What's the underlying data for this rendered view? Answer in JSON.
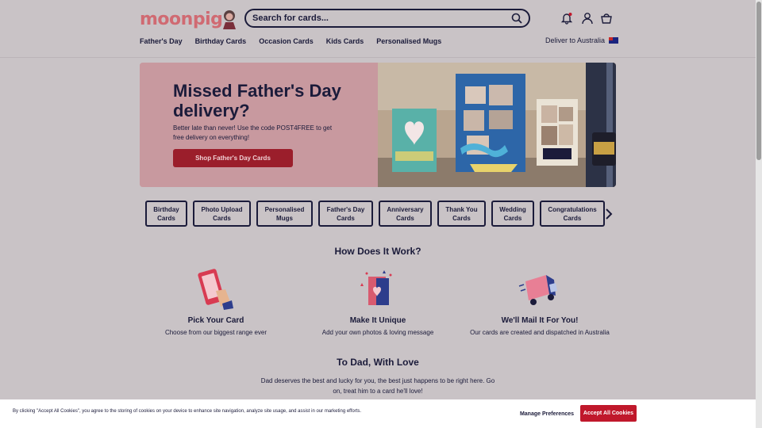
{
  "header": {
    "logo_text": "moonpig",
    "search_placeholder": "Search for cards...",
    "icons": [
      "search-icon",
      "bell-icon",
      "account-icon",
      "basket-icon"
    ]
  },
  "nav": {
    "items": [
      "Father's Day",
      "Birthday Cards",
      "Occasion Cards",
      "Kids Cards",
      "Personalised Mugs"
    ],
    "deliver_label": "Deliver to Australia"
  },
  "hero": {
    "title": "Missed Father's Day delivery?",
    "subtitle": "Better late than never! Use the code POST4FREE to get free delivery on everything!",
    "cta_label": "Shop Father's Day Cards"
  },
  "categories": [
    "Birthday\nCards",
    "Photo Upload\nCards",
    "Personalised\nMugs",
    "Father's Day\nCards",
    "Anniversary\nCards",
    "Thank You\nCards",
    "Wedding\nCards",
    "Congratulations\nCards"
  ],
  "how": {
    "title": "How Does It Work?",
    "steps": [
      {
        "title": "Pick Your Card",
        "desc": "Choose from our biggest range ever"
      },
      {
        "title": "Make It Unique",
        "desc": "Add your own photos & loving message"
      },
      {
        "title": "We'll Mail It For You!",
        "desc": "Our cards are created and dispatched in Australia"
      }
    ]
  },
  "dad": {
    "title": "To Dad, With Love",
    "desc": "Dad deserves the best and lucky for you, the best just happens to be right here. Go on, treat him to a card he'll love!"
  },
  "cookie": {
    "text": "By clicking \"Accept All Cookies\", you agree to the storing of cookies on your device to enhance site navigation, analyze site usage, and assist in our marketing efforts.",
    "manage_label": "Manage Preferences",
    "accept_label": "Accept All Cookies"
  },
  "colors": {
    "navy": "#1b1b3a",
    "brand_pink": "#d06a72",
    "cta_red": "#9b1e2b",
    "accept_red": "#c0182b"
  }
}
